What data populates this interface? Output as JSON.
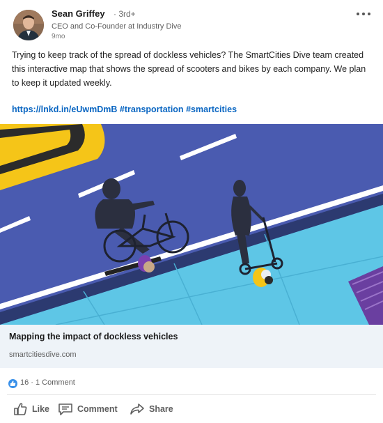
{
  "author": {
    "name": "Sean Griffey",
    "degree": "· 3rd+",
    "headline": "CEO and Co-Founder at Industry Dive",
    "time": "9mo"
  },
  "post": {
    "text": "Trying to keep track of the spread of dockless vehicles?  The SmartCities Dive team created this interactive map that shows the spread of scooters and bikes by each company.  We plan to keep it updated weekly.",
    "link": "https://lnkd.in/eUwmDmB",
    "hashtags": [
      "#transportation",
      "#smartcities"
    ]
  },
  "article": {
    "title": "Mapping the impact of dockless vehicles",
    "source": "smartcitiesdive.com"
  },
  "social": {
    "counts": "16 · 1 Comment"
  },
  "actions": {
    "like": "Like",
    "comment": "Comment",
    "share": "Share"
  },
  "colors": {
    "link": "#0a66c2",
    "road": "#4a5bb0",
    "sidewalk": "#5ec6e6",
    "taxi": "#f5c518",
    "like_badge": "#378fe9"
  },
  "icons": [
    "more-options-icon",
    "like-reaction-icon",
    "thumbs-up-icon",
    "comment-icon",
    "share-icon"
  ]
}
